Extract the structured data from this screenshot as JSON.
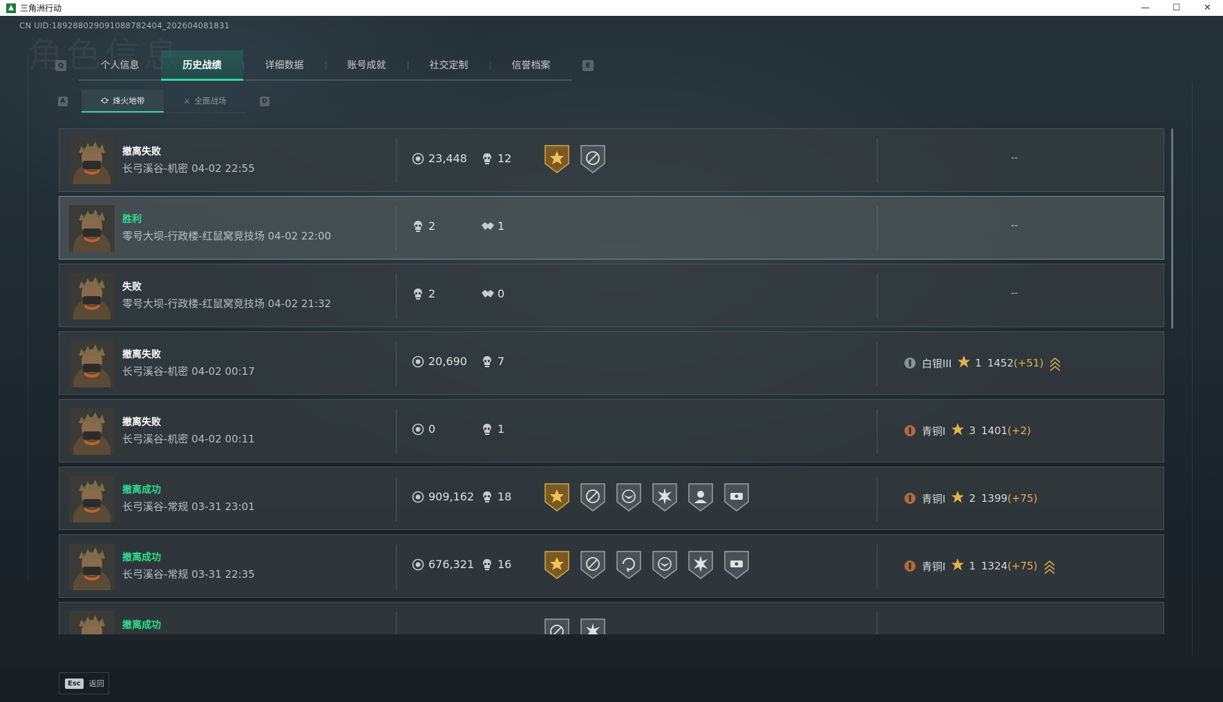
{
  "window": {
    "title": "三角洲行动",
    "controls": {
      "minimize": "—",
      "maximize": "☐",
      "close": "✕"
    }
  },
  "uid_text": "CN UID:18928802909108878​2404_202604081831",
  "watermark": "角色信息",
  "main_tabs": {
    "left_key": "Q",
    "right_key": "E",
    "items": [
      {
        "label": "个人信息",
        "active": false
      },
      {
        "label": "历史战绩",
        "active": true
      },
      {
        "label": "详细数据",
        "active": false
      },
      {
        "label": "账号成就",
        "active": false
      },
      {
        "label": "社交定制",
        "active": false
      },
      {
        "label": "信誉档案",
        "active": false
      }
    ]
  },
  "sub_tabs": {
    "left_key": "A",
    "right_key": "D",
    "items": [
      {
        "label": "烽火地带",
        "icon": "flame-zone-icon",
        "active": true
      },
      {
        "label": "全面战场",
        "icon": "battlefield-icon",
        "active": false
      }
    ]
  },
  "records": [
    {
      "result": "撤离失败",
      "win": false,
      "map": "长弓溪谷-机密 04-02 22:55",
      "value": "23,448",
      "kills": "12",
      "badges": [
        "gold-star-badge",
        "crosshair-badge"
      ],
      "rank": null,
      "dash": "--"
    },
    {
      "result": "胜利",
      "win": true,
      "map": "零号大坝-行政楼-红鼠窝竞技场 04-02 22:00",
      "kills": "2",
      "assists": "1",
      "badges": [],
      "rank": null,
      "dash": "--",
      "highlight": true
    },
    {
      "result": "失败",
      "win": false,
      "map": "零号大坝-行政楼-红鼠窝竞技场 04-02 21:32",
      "kills": "2",
      "assists": "0",
      "badges": [],
      "rank": null,
      "dash": "--"
    },
    {
      "result": "撤离失败",
      "win": false,
      "map": "长弓溪谷-机密 04-02 00:17",
      "value": "20,690",
      "kills": "7",
      "badges": [],
      "rank": {
        "tier": "白银III",
        "stars": "1",
        "points": "1452",
        "delta": "(+51)",
        "up": true,
        "tier_color": "#9aa3a7"
      },
      "dash": null
    },
    {
      "result": "撤离失败",
      "win": false,
      "map": "长弓溪谷-机密 04-02 00:11",
      "value": "0",
      "kills": "1",
      "badges": [],
      "rank": {
        "tier": "青铜I",
        "stars": "3",
        "points": "1401",
        "delta": "(+2)",
        "up": false,
        "tier_color": "#c8763e"
      },
      "dash": null
    },
    {
      "result": "撤离成功",
      "win": true,
      "map": "长弓溪谷-常规 03-31 23:01",
      "value": "909,162",
      "kills": "18",
      "badges": [
        "gold-star-badge",
        "crosshair-badge",
        "eagle-badge",
        "burst-badge",
        "operator-badge",
        "cash-badge"
      ],
      "rank": {
        "tier": "青铜I",
        "stars": "2",
        "points": "1399",
        "delta": "(+75)",
        "up": false,
        "tier_color": "#c8763e"
      },
      "dash": null
    },
    {
      "result": "撤离成功",
      "win": true,
      "map": "长弓溪谷-常规 03-31 22:35",
      "value": "676,321",
      "kills": "16",
      "badges": [
        "gold-star-badge",
        "crosshair-badge",
        "rotate-badge",
        "eagle-badge",
        "burst-badge",
        "cash-badge"
      ],
      "rank": {
        "tier": "青铜I",
        "stars": "1",
        "points": "1324",
        "delta": "(+75)",
        "up": true,
        "tier_color": "#c8763e"
      },
      "dash": null
    },
    {
      "result": "撤离成功",
      "win": true,
      "map": "",
      "value": "",
      "kills": "",
      "badges": [
        "crosshair-badge",
        "burst-badge"
      ],
      "rank": null,
      "dash": null
    }
  ],
  "footer": {
    "esc_key": "Esc",
    "esc_label": "返回"
  },
  "colors": {
    "accent": "#33d6a4",
    "win": "#2fe08e",
    "gold": "#e2b24a"
  }
}
